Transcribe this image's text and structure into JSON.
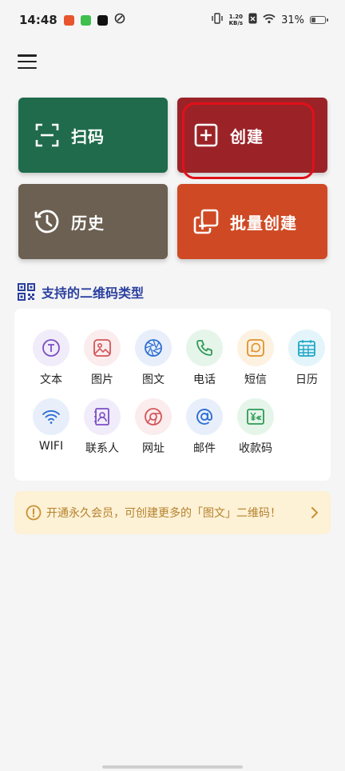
{
  "status_bar": {
    "time": "14:48",
    "net_speed_value": "1.20",
    "net_speed_unit": "KB/s",
    "battery": "31%",
    "battery_level": 0.31
  },
  "actions": {
    "scan": "扫码",
    "create": "创建",
    "history": "历史",
    "batch_create": "批量创建"
  },
  "section": {
    "title": "支持的二维码类型"
  },
  "types": [
    {
      "label": "文本",
      "icon": "text-icon",
      "color": "#7b4fc6",
      "bg": "#f1ecfa"
    },
    {
      "label": "图片",
      "icon": "image-icon",
      "color": "#d2565a",
      "bg": "#fbeced"
    },
    {
      "label": "图文",
      "icon": "aperture-icon",
      "color": "#2f6fd1",
      "bg": "#e8effb"
    },
    {
      "label": "电话",
      "icon": "phone-icon",
      "color": "#2e9a55",
      "bg": "#e6f5ea"
    },
    {
      "label": "短信",
      "icon": "message-icon",
      "color": "#e0912a",
      "bg": "#fdf2e2"
    },
    {
      "label": "日历",
      "icon": "calendar-icon",
      "color": "#1ea6c7",
      "bg": "#e3f5fa"
    },
    {
      "label": "WIFI",
      "icon": "wifi-icon",
      "color": "#2f6fd1",
      "bg": "#e8effb"
    },
    {
      "label": "联系人",
      "icon": "contact-icon",
      "color": "#7b4fc6",
      "bg": "#f1ecfa"
    },
    {
      "label": "网址",
      "icon": "browser-icon",
      "color": "#d2565a",
      "bg": "#fbeced"
    },
    {
      "label": "邮件",
      "icon": "at-icon",
      "color": "#2f6fd1",
      "bg": "#e8effb"
    },
    {
      "label": "收款码",
      "icon": "payment-icon",
      "color": "#2e9a55",
      "bg": "#e6f5ea"
    }
  ],
  "banner": {
    "text": "开通永久会员，可创建更多的「图文」二维码！"
  }
}
